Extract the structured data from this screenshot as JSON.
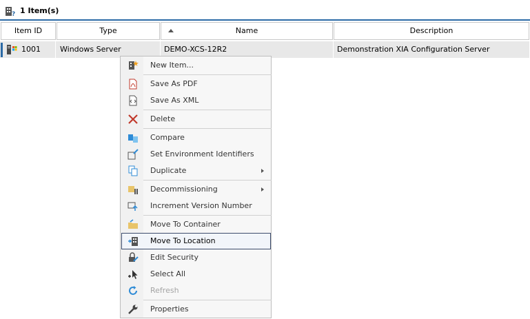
{
  "header": {
    "count_label": "1 Item(s)",
    "icon": "building-query-icon"
  },
  "grid": {
    "columns": [
      {
        "label": "Item ID"
      },
      {
        "label": "Type"
      },
      {
        "label": "Name",
        "sorted": "ascending"
      },
      {
        "label": "Description"
      }
    ],
    "rows": [
      {
        "icon": "server-icon",
        "id": "1001",
        "type": "Windows Server",
        "name": "DEMO-XCS-12R2",
        "description": "Demonstration XIA Configuration Server"
      }
    ]
  },
  "context_menu": {
    "items": [
      {
        "label": "New Item...",
        "icon": "new-item-icon"
      },
      {
        "label": "Save As PDF",
        "icon": "pdf-icon"
      },
      {
        "label": "Save As XML",
        "icon": "xml-icon"
      },
      {
        "label": "Delete",
        "icon": "delete-icon"
      },
      {
        "label": "Compare",
        "icon": "compare-icon"
      },
      {
        "label": "Set Environment Identifiers",
        "icon": "environment-icon"
      },
      {
        "label": "Duplicate",
        "icon": "duplicate-icon",
        "submenu": true
      },
      {
        "label": "Decommissioning",
        "icon": "decommission-icon",
        "submenu": true
      },
      {
        "label": "Increment Version Number",
        "icon": "version-icon"
      },
      {
        "label": "Move To Container",
        "icon": "container-icon"
      },
      {
        "label": "Move To Location",
        "icon": "location-icon",
        "highlighted": true
      },
      {
        "label": "Edit Security",
        "icon": "security-icon"
      },
      {
        "label": "Select All",
        "icon": "select-all-icon"
      },
      {
        "label": "Refresh",
        "icon": "refresh-icon",
        "disabled": true
      },
      {
        "label": "Properties",
        "icon": "wrench-icon"
      }
    ]
  },
  "colors": {
    "accent": "#2b6aa6",
    "row_selected": "#e8e8e8",
    "menu_hover_border": "#3b4a6b",
    "disabled_text": "#a4a4a4"
  }
}
